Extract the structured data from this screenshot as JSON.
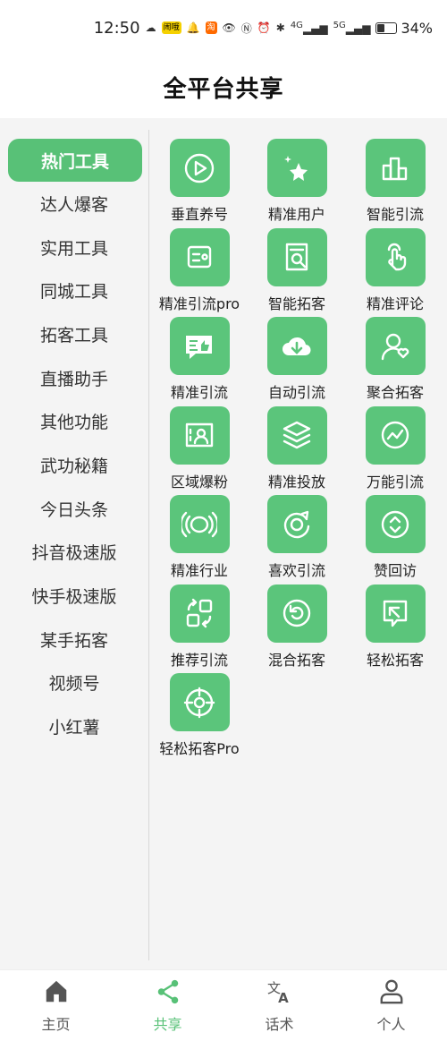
{
  "status_bar": {
    "time": "12:50",
    "battery": "34%",
    "battery_level": 0.34,
    "badge_1": "闹哦",
    "badge_2": "淘",
    "net_1": "4G",
    "net_2": "5G"
  },
  "header": {
    "title": "全平台共享"
  },
  "sidebar": {
    "items": [
      {
        "label": "热门工具",
        "active": true
      },
      {
        "label": "达人爆客"
      },
      {
        "label": "实用工具"
      },
      {
        "label": "同城工具"
      },
      {
        "label": "拓客工具"
      },
      {
        "label": "直播助手"
      },
      {
        "label": "其他功能"
      },
      {
        "label": "武功秘籍"
      },
      {
        "label": "今日头条"
      },
      {
        "label": "抖音极速版"
      },
      {
        "label": "快手极速版"
      },
      {
        "label": "某手拓客"
      },
      {
        "label": "视频号"
      },
      {
        "label": "小红薯"
      }
    ]
  },
  "tools": [
    {
      "label": "垂直养号",
      "icon": "play-circle-icon"
    },
    {
      "label": "精准用户",
      "icon": "sparkle-star-icon"
    },
    {
      "label": "智能引流",
      "icon": "bar-chart-icon"
    },
    {
      "label": "精准引流pro",
      "icon": "id-card-icon"
    },
    {
      "label": "智能拓客",
      "icon": "document-search-icon"
    },
    {
      "label": "精准评论",
      "icon": "tap-hand-icon"
    },
    {
      "label": "精准引流",
      "icon": "chat-thumbs-up-icon"
    },
    {
      "label": "自动引流",
      "icon": "cloud-download-icon"
    },
    {
      "label": "聚合拓客",
      "icon": "user-heart-icon"
    },
    {
      "label": "区域爆粉",
      "icon": "profile-frame-icon"
    },
    {
      "label": "精准投放",
      "icon": "layers-icon"
    },
    {
      "label": "万能引流",
      "icon": "trend-circle-icon"
    },
    {
      "label": "精准行业",
      "icon": "broadcast-icon"
    },
    {
      "label": "喜欢引流",
      "icon": "target-refresh-icon"
    },
    {
      "label": "赞回访",
      "icon": "scroll-up-down-icon"
    },
    {
      "label": "推荐引流",
      "icon": "swap-squares-icon"
    },
    {
      "label": "混合拓客",
      "icon": "undo-circle-icon"
    },
    {
      "label": "轻松拓客",
      "icon": "return-bubble-icon"
    },
    {
      "label": "轻松拓客Pro",
      "icon": "crosshair-icon"
    }
  ],
  "bottom_nav": [
    {
      "label": "主页",
      "icon": "home-icon"
    },
    {
      "label": "共享",
      "icon": "share-icon",
      "active": true
    },
    {
      "label": "话术",
      "icon": "translate-icon"
    },
    {
      "label": "个人",
      "icon": "person-icon"
    }
  ],
  "colors": {
    "accent": "#58c177",
    "tile": "#5bc57b"
  }
}
